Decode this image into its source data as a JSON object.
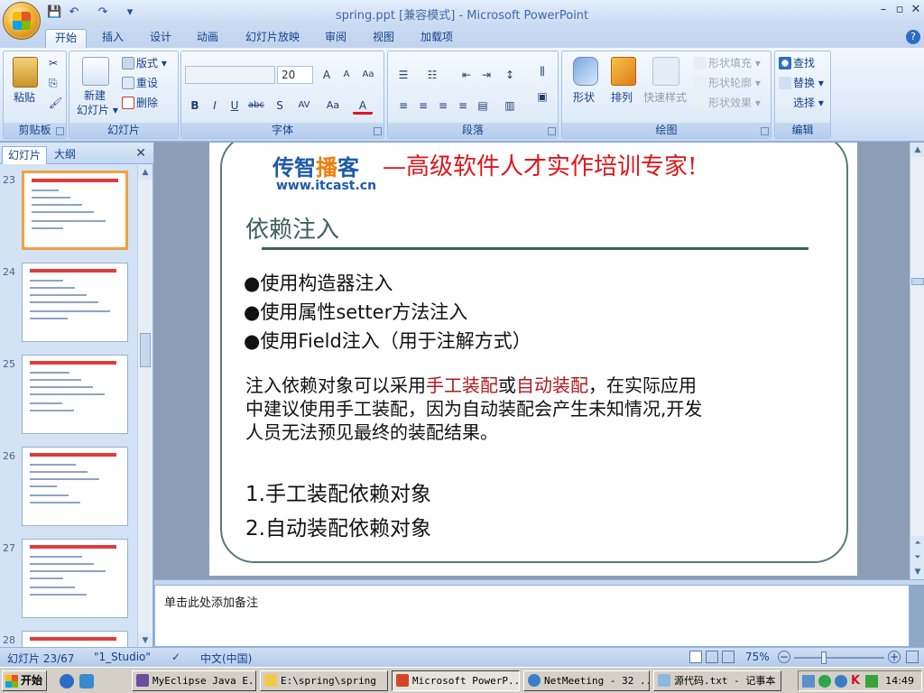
{
  "window": {
    "title": "spring.ppt [兼容模式] - Microsoft PowerPoint",
    "min": "–",
    "restore": "▫",
    "close": "✕"
  },
  "qat": {
    "save": "💾",
    "undo": "↶",
    "redo": "↷",
    "more": "▾"
  },
  "tabs": [
    "开始",
    "插入",
    "设计",
    "动画",
    "幻灯片放映",
    "审阅",
    "视图",
    "加载项"
  ],
  "help": "?",
  "ribbon": {
    "clipboard": {
      "label": "剪贴板",
      "paste": "粘贴",
      "cut": "✂",
      "copy": "⎘",
      "format_painter": "🖌"
    },
    "slides": {
      "label": "幻灯片",
      "new_slide": "新建\n幻灯片",
      "new_slide_arrow": "▾",
      "layout": "版式",
      "reset": "重设",
      "delete": "删除"
    },
    "font": {
      "label": "字体",
      "font_name": "",
      "font_size": "20",
      "grow": "A",
      "shrink": "A",
      "clear": "Aa",
      "bold": "B",
      "italic": "I",
      "underline": "U",
      "strike": "abc",
      "shadow": "S",
      "spacing": "AV",
      "case": "Aa",
      "color": "A"
    },
    "paragraph": {
      "label": "段落"
    },
    "drawing": {
      "label": "绘图",
      "shapes": "形状",
      "arrange": "排列",
      "quick_styles": "快速样式",
      "fill": "形状填充",
      "outline": "形状轮廓",
      "effects": "形状效果"
    },
    "editing": {
      "label": "编辑",
      "find": "查找",
      "replace": "替换",
      "select": "选择"
    }
  },
  "left_pane": {
    "tabs": [
      "幻灯片",
      "大纲"
    ],
    "close": "✕",
    "thumbnails": [
      {
        "num": "23",
        "selected": true
      },
      {
        "num": "24",
        "selected": false
      },
      {
        "num": "25",
        "selected": false
      },
      {
        "num": "26",
        "selected": false
      },
      {
        "num": "27",
        "selected": false
      },
      {
        "num": "28",
        "selected": false
      }
    ]
  },
  "slide": {
    "brand_a": "传智",
    "brand_b": "播",
    "brand_c": "客",
    "brand_url": "www.itcast.cn",
    "slogan": "—高级软件人才实作培训专家!",
    "title": "依赖注入",
    "bullets": [
      "●使用构造器注入",
      "●使用属性setter方法注入",
      "●使用Field注入（用于注解方式）"
    ],
    "para": {
      "p1": "注入依赖对象可以采用",
      "r1": "手工装配",
      "p2": "或",
      "r2": "自动装配",
      "p3": "，在实际应用",
      "line2": "中建议使用手工装配，因为自动装配会产生未知情况,开发",
      "line3": "人员无法预见最终的装配结果。"
    },
    "numbered": [
      "1.手工装配依赖对象",
      "2.自动装配依赖对象"
    ]
  },
  "notes": {
    "placeholder": "单击此处添加备注"
  },
  "status": {
    "slide": "幻灯片 23/67",
    "theme": "\"1_Studio\"",
    "lang": "中文(中国)",
    "zoom": "75%",
    "zoom_level": 0.75,
    "minus": "−",
    "plus": "+"
  },
  "taskbar": {
    "start": "开始",
    "items": [
      {
        "label": "MyEclipse Java E..."
      },
      {
        "label": "E:\\spring\\spring"
      },
      {
        "label": "Microsoft PowerP..."
      },
      {
        "label": "NetMeeting - 32 ..."
      },
      {
        "label": "源代码.txt - 记事本"
      }
    ],
    "clock": "14:49"
  },
  "colors": {
    "accent": "#15428b",
    "selection": "#f0a040",
    "slogan_red": "#e0151a",
    "brand_blue": "#1e5aa8"
  }
}
